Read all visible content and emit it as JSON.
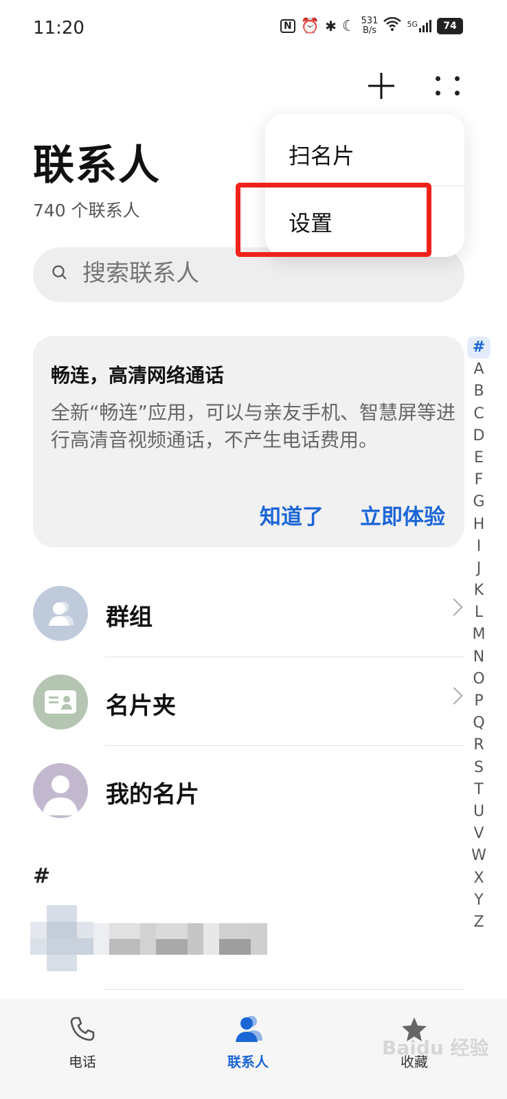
{
  "status_bar": {
    "time": "11:20",
    "net_speed_value": "531",
    "net_speed_unit": "B/s",
    "signal_label": "5G",
    "battery": "74"
  },
  "header": {
    "title": "联系人",
    "contact_count": "740 个联系人"
  },
  "popup_menu": {
    "items": [
      {
        "label": "扫名片"
      },
      {
        "label": "设置"
      }
    ]
  },
  "search": {
    "placeholder": "搜索联系人"
  },
  "promo": {
    "title": "畅连，高清网络通话",
    "description": "全新“畅连”应用，可以与亲友手机、智慧屏等进行高清音视频通话，不产生电话费用。",
    "dismiss_label": "知道了",
    "try_label": "立即体验"
  },
  "entries": [
    {
      "label": "群组",
      "icon": "group-icon",
      "color": "#bfcbdb"
    },
    {
      "label": "名片夹",
      "icon": "business-card-icon",
      "color": "#b4c5b1"
    },
    {
      "label": "我的名片",
      "icon": "person-icon",
      "color": "#c3b9cf"
    }
  ],
  "section_header": "#",
  "index_bar": [
    "#",
    "A",
    "B",
    "C",
    "D",
    "E",
    "F",
    "G",
    "H",
    "I",
    "J",
    "K",
    "L",
    "M",
    "N",
    "O",
    "P",
    "Q",
    "R",
    "S",
    "T",
    "U",
    "V",
    "W",
    "X",
    "Y",
    "Z"
  ],
  "bottom_nav": [
    {
      "label": "电话",
      "icon": "phone-icon",
      "active": false
    },
    {
      "label": "联系人",
      "icon": "contacts-icon",
      "active": true
    },
    {
      "label": "收藏",
      "icon": "star-icon",
      "active": false
    }
  ],
  "watermark": "Baidu 经验",
  "colors": {
    "accent": "#1b66d6",
    "highlight": "#f0231c"
  }
}
